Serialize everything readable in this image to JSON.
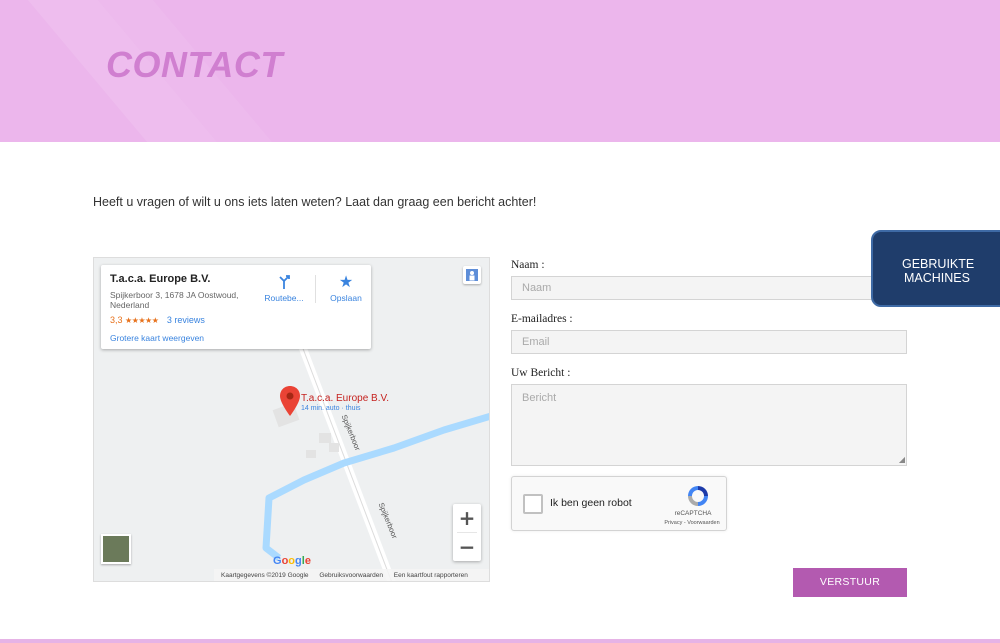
{
  "header": {
    "title": "CONTACT"
  },
  "intro": {
    "text": "Heeft u vragen of wilt u ons iets laten weten? Laat dan graag een bericht achter!"
  },
  "map": {
    "card": {
      "name": "T.a.c.a. Europe B.V.",
      "address": "Spijkerboor 3, 1678 JA Oostwoud, Nederland",
      "rating": "3,3",
      "stars": "★★★★★",
      "reviews": "3 reviews",
      "bigger_map": "Grotere kaart weergeven",
      "route_label": "Routebe...",
      "save_label": "Opslaan"
    },
    "pin": {
      "label": "T.a.c.a. Europe B.V.",
      "sub": "14 min. auto · thuis"
    },
    "streets": [
      "Spijkerboor",
      "Spijkerboor"
    ],
    "zoom_in": "+",
    "zoom_out": "−",
    "google_logo": {
      "g1": "G",
      "o1": "o",
      "o2": "o",
      "g2": "g",
      "l": "l",
      "e": "e"
    },
    "footer": {
      "data": "Kaartgegevens ©2019 Google",
      "terms": "Gebruiksvoorwaarden",
      "report": "Een kaartfout rapporteren"
    }
  },
  "form": {
    "name_label": "Naam :",
    "name_placeholder": "Naam",
    "email_label": "E-mailadres :",
    "email_placeholder": "Email",
    "message_label": "Uw Bericht :",
    "message_placeholder": "Bericht",
    "captcha": {
      "text": "Ik ben geen robot",
      "brand": "reCAPTCHA",
      "links": "Privacy - Voorwaarden"
    },
    "submit_label": "VERSTUUR"
  },
  "side_tab": {
    "line1": "GEBRUIKTE",
    "line2": "MACHINES"
  },
  "colors": {
    "header_bg": "#ecb6ec",
    "title": "#d07fd0",
    "button": "#b35ab0",
    "side_tab": "#1f3d6b"
  }
}
